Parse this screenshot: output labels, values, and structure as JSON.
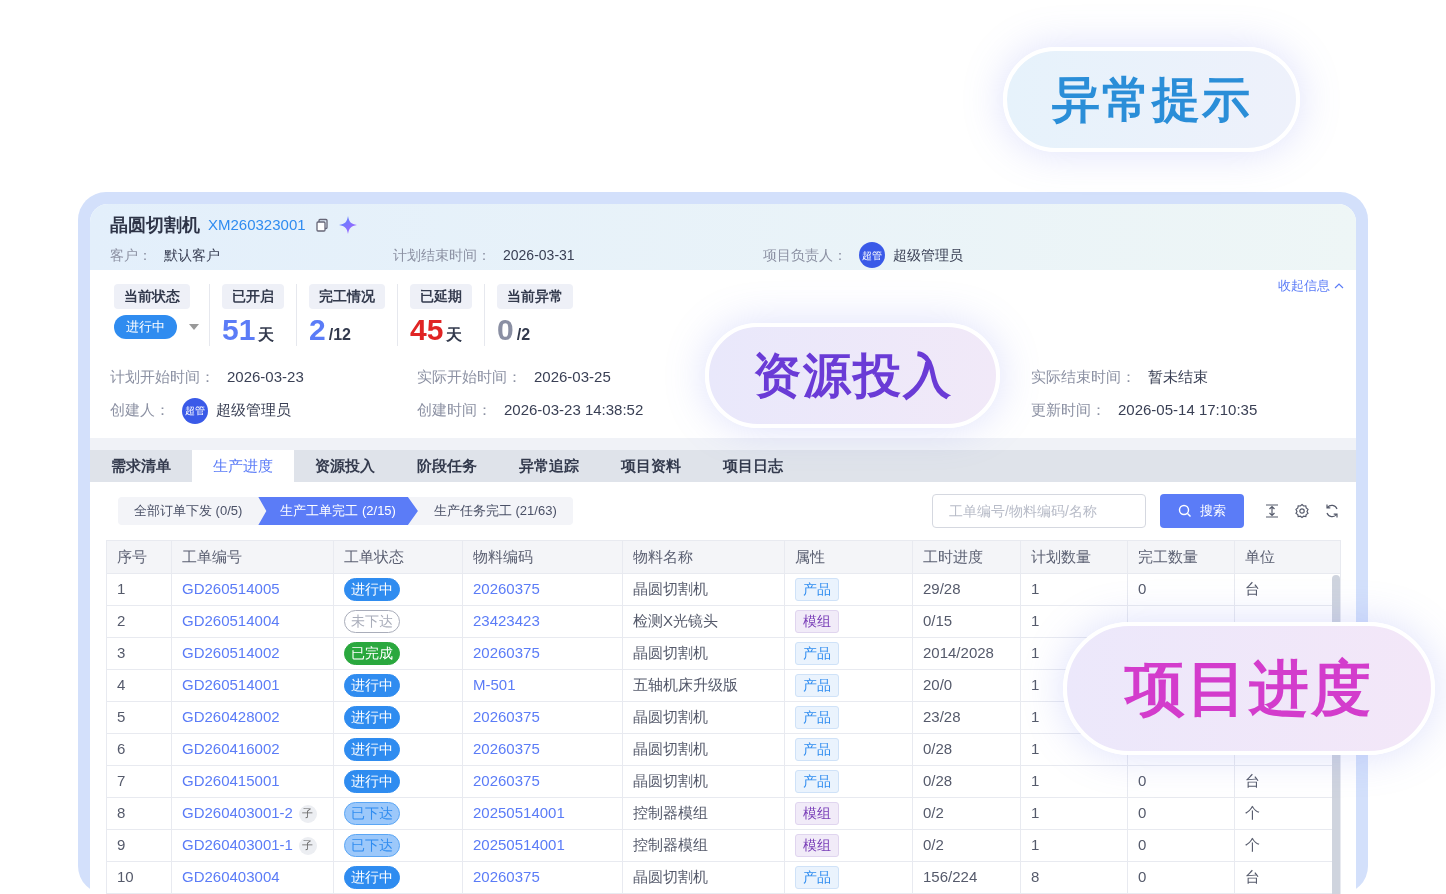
{
  "callouts": [
    {
      "kind": "alert",
      "text": "异常提示"
    },
    {
      "kind": "resource",
      "text": "资源投入"
    },
    {
      "kind": "progress",
      "text": "项目进度"
    }
  ],
  "project": {
    "name": "晶圆切割机",
    "code": "XM260323001",
    "customer_label": "客户：",
    "customer": "默认客户",
    "plan_end_label": "计划结束时间：",
    "plan_end": "2026-03-31",
    "owner_label": "项目负责人：",
    "owner_avatar": "超管",
    "owner": "超级管理员"
  },
  "collapse_link": "收起信息",
  "stats": [
    {
      "kind": "status",
      "label": "当前状态",
      "value": "进行中"
    },
    {
      "kind": "count",
      "label": "已开启",
      "value": "51",
      "unit": "天",
      "color": "#5b7cf7"
    },
    {
      "kind": "count",
      "label": "完工情况",
      "value": "2",
      "unit": "/12",
      "color": "#5b7cf7"
    },
    {
      "kind": "count",
      "label": "已延期",
      "value": "45",
      "unit": "天",
      "color": "#e02424"
    },
    {
      "kind": "count",
      "label": "当前异常",
      "value": "0",
      "unit": "/2",
      "color": "#8a8fa3"
    }
  ],
  "info_columns": [
    [
      {
        "kind": "text",
        "label": "计划开始时间：",
        "value": "2026-03-23"
      },
      {
        "kind": "user",
        "label": "创建人：",
        "avatar": "超管",
        "value": "超级管理员"
      }
    ],
    [
      {
        "kind": "text",
        "label": "实际开始时间：",
        "value": "2026-03-25"
      },
      {
        "kind": "text",
        "label": "创建时间：",
        "value": "2026-03-23 14:38:52"
      }
    ],
    [
      {
        "kind": "text",
        "label": "实际结束时间：",
        "value": "暂未结束"
      },
      {
        "kind": "text",
        "label": "更新时间：",
        "value": "2026-05-14 17:10:35"
      }
    ]
  ],
  "tabs": [
    {
      "label": "需求清单",
      "selected": false
    },
    {
      "label": "生产进度",
      "selected": true
    },
    {
      "label": "资源投入",
      "selected": false
    },
    {
      "label": "阶段任务",
      "selected": false
    },
    {
      "label": "异常追踪",
      "selected": false
    },
    {
      "label": "项目资料",
      "selected": false
    },
    {
      "label": "项目日志",
      "selected": false
    }
  ],
  "steps": [
    {
      "label": "全部订单下发 (0/5)",
      "selected": false
    },
    {
      "label": "生产工单完工 (2/15)",
      "selected": true
    },
    {
      "label": "生产任务完工 (21/63)",
      "selected": false
    }
  ],
  "search": {
    "placeholder": "工单编号/物料编码/名称"
  },
  "search_button": "搜索",
  "table": {
    "columns": [
      "序号",
      "工单编号",
      "工单状态",
      "物料编码",
      "物料名称",
      "属性",
      "工时进度",
      "计划数量",
      "完工数量",
      "单位"
    ],
    "rows": [
      {
        "no": "1",
        "order": "GD260514005",
        "status": {
          "kind": "running",
          "text": "进行中"
        },
        "code": "20260375",
        "name": "晶圆切割机",
        "attr": {
          "kind": "product",
          "text": "产品"
        },
        "hours": "29/28",
        "planned": "1",
        "done": "0",
        "unit": "台"
      },
      {
        "no": "2",
        "order": "GD260514004",
        "status": {
          "kind": "pending",
          "text": "未下达"
        },
        "code": "23423423",
        "name": "检测X光镜头",
        "attr": {
          "kind": "module",
          "text": "模组"
        },
        "hours": "0/15",
        "planned": "1"
      },
      {
        "no": "3",
        "order": "GD260514002",
        "status": {
          "kind": "finished",
          "text": "已完成"
        },
        "code": "20260375",
        "name": "晶圆切割机",
        "attr": {
          "kind": "product",
          "text": "产品"
        },
        "hours": "2014/2028",
        "planned": "1"
      },
      {
        "no": "4",
        "order": "GD260514001",
        "status": {
          "kind": "running",
          "text": "进行中"
        },
        "code": "M-501",
        "name": "五轴机床升级版",
        "attr": {
          "kind": "product",
          "text": "产品"
        },
        "hours": "20/0",
        "planned": "1"
      },
      {
        "no": "5",
        "order": "GD260428002",
        "status": {
          "kind": "running",
          "text": "进行中"
        },
        "code": "20260375",
        "name": "晶圆切割机",
        "attr": {
          "kind": "product",
          "text": "产品"
        },
        "hours": "23/28",
        "planned": "1"
      },
      {
        "no": "6",
        "order": "GD260416002",
        "status": {
          "kind": "running",
          "text": "进行中"
        },
        "code": "20260375",
        "name": "晶圆切割机",
        "attr": {
          "kind": "product",
          "text": "产品"
        },
        "hours": "0/28",
        "planned": "1"
      },
      {
        "no": "7",
        "order": "GD260415001",
        "status": {
          "kind": "running",
          "text": "进行中"
        },
        "code": "20260375",
        "name": "晶圆切割机",
        "attr": {
          "kind": "product",
          "text": "产品"
        },
        "hours": "0/28",
        "planned": "1",
        "done": "0",
        "unit": "台"
      },
      {
        "no": "8",
        "order": "GD260403001-2",
        "sub": "子",
        "status": {
          "kind": "issued",
          "text": "已下达"
        },
        "code": "20250514001",
        "name": "控制器模组",
        "attr": {
          "kind": "module",
          "text": "模组"
        },
        "hours": "0/2",
        "planned": "1",
        "done": "0",
        "unit": "个"
      },
      {
        "no": "9",
        "order": "GD260403001-1",
        "sub": "子",
        "status": {
          "kind": "issued",
          "text": "已下达"
        },
        "code": "20250514001",
        "name": "控制器模组",
        "attr": {
          "kind": "module",
          "text": "模组"
        },
        "hours": "0/2",
        "planned": "1",
        "done": "0",
        "unit": "个"
      },
      {
        "no": "10",
        "order": "GD260403004",
        "status": {
          "kind": "running",
          "text": "进行中"
        },
        "code": "20260375",
        "name": "晶圆切割机",
        "attr": {
          "kind": "product",
          "text": "产品"
        },
        "hours": "156/224",
        "planned": "8",
        "done": "0",
        "unit": "台"
      }
    ]
  }
}
